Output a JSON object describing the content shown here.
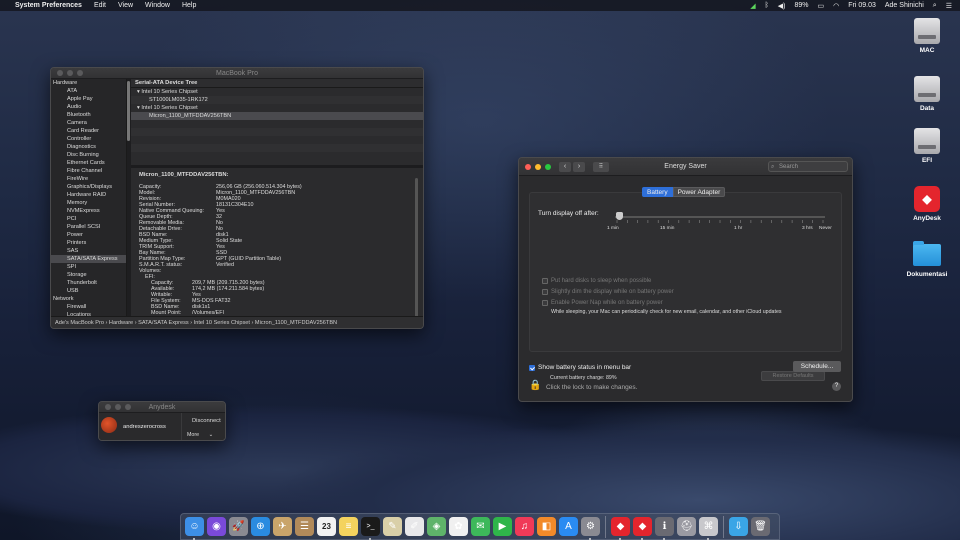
{
  "menubar": {
    "apple": "",
    "app": "System Preferences",
    "items": [
      "Edit",
      "View",
      "Window",
      "Help"
    ],
    "battery": "89%",
    "clock": "Fri 09.03",
    "user": "Ade Shinichi"
  },
  "sysinfo": {
    "title": "MacBook Pro",
    "sidebar": [
      {
        "label": "Hardware",
        "type": "grp"
      },
      {
        "label": "ATA"
      },
      {
        "label": "Apple Pay"
      },
      {
        "label": "Audio"
      },
      {
        "label": "Bluetooth"
      },
      {
        "label": "Camera"
      },
      {
        "label": "Card Reader"
      },
      {
        "label": "Controller"
      },
      {
        "label": "Diagnostics"
      },
      {
        "label": "Disc Burning"
      },
      {
        "label": "Ethernet Cards"
      },
      {
        "label": "Fibre Channel"
      },
      {
        "label": "FireWire"
      },
      {
        "label": "Graphics/Displays"
      },
      {
        "label": "Hardware RAID"
      },
      {
        "label": "Memory"
      },
      {
        "label": "NVMExpress"
      },
      {
        "label": "PCI"
      },
      {
        "label": "Parallel SCSI"
      },
      {
        "label": "Power"
      },
      {
        "label": "Printers"
      },
      {
        "label": "SAS"
      },
      {
        "label": "SATA/SATA Express",
        "selected": true
      },
      {
        "label": "SPI"
      },
      {
        "label": "Storage"
      },
      {
        "label": "Thunderbolt"
      },
      {
        "label": "USB"
      },
      {
        "label": "Network",
        "type": "grp"
      },
      {
        "label": "Firewall"
      },
      {
        "label": "Locations"
      }
    ],
    "tree_header": "Serial-ATA Device Tree",
    "tree": [
      {
        "label": "Intel 10 Series Chipset",
        "level": 1
      },
      {
        "label": "ST1000LM035-1RK172",
        "level": 2
      },
      {
        "label": "Intel 10 Series Chipset",
        "level": 1
      },
      {
        "label": "Micron_1100_MTFDDAV256TBN",
        "level": 2,
        "selected": true
      }
    ],
    "detail_title": "Micron_1100_MTFDDAV256TBN:",
    "details": [
      {
        "k": "Capacity:",
        "v": "256,06 GB (256.060.514.304 bytes)",
        "lvl": 1
      },
      {
        "k": "Model:",
        "v": "Micron_1100_MTFDDAV256TBN",
        "lvl": 1
      },
      {
        "k": "Revision:",
        "v": "M0MA020",
        "lvl": 1
      },
      {
        "k": "Serial Number:",
        "v": "18131C304E10",
        "lvl": 1
      },
      {
        "k": "Native Command Queuing:",
        "v": "Yes",
        "lvl": 1
      },
      {
        "k": "Queue Depth:",
        "v": "32",
        "lvl": 1
      },
      {
        "k": "Removable Media:",
        "v": "No",
        "lvl": 1
      },
      {
        "k": "Detachable Drive:",
        "v": "No",
        "lvl": 1
      },
      {
        "k": "BSD Name:",
        "v": "disk1",
        "lvl": 1
      },
      {
        "k": "Medium Type:",
        "v": "Solid State",
        "lvl": 1
      },
      {
        "k": "TRIM Support:",
        "v": "Yes",
        "lvl": 1
      },
      {
        "k": "Bay Name:",
        "v": "SSD",
        "lvl": 1
      },
      {
        "k": "Partition Map Type:",
        "v": "GPT (GUID Partition Table)",
        "lvl": 1
      },
      {
        "k": "S.M.A.R.T. status:",
        "v": "Verified",
        "lvl": 1
      },
      {
        "k": "Volumes:",
        "v": "",
        "lvl": 1
      },
      {
        "k": "EFI:",
        "v": "",
        "lvl": 2
      },
      {
        "k": "Capacity:",
        "v": "209,7 MB (209.715.200 bytes)",
        "lvl": 3
      },
      {
        "k": "Available:",
        "v": "174,2 MB (174.211.584 bytes)",
        "lvl": 3
      },
      {
        "k": "Writable:",
        "v": "Yes",
        "lvl": 3
      },
      {
        "k": "File System:",
        "v": "MS-DOS FAT32",
        "lvl": 3
      },
      {
        "k": "BSD Name:",
        "v": "disk1s1",
        "lvl": 3
      },
      {
        "k": "Mount Point:",
        "v": "/Volumes/EFI",
        "lvl": 3
      }
    ],
    "path": "Ade's MacBook Pro  ›  Hardware  ›  SATA/SATA Express  ›  Intel 10 Series Chipset  ›  Micron_1100_MTFDDAV256TBN"
  },
  "energy": {
    "title": "Energy Saver",
    "search_placeholder": "Search",
    "tabs": [
      "Battery",
      "Power Adapter"
    ],
    "turn_off_label": "Turn display off after:",
    "slider_labels": [
      "1 min",
      "15 min",
      "1 hr",
      "3 hrs",
      "Never"
    ],
    "slider_value": "1 min",
    "options": [
      "Put hard disks to sleep when possible",
      "Slightly dim the display while on battery power",
      "Enable Power Nap while on battery power"
    ],
    "power_nap_desc": "While sleeping, your Mac can periodically check for new email, calendar, and other iCloud updates",
    "charge": "Current battery charge: 89%",
    "restore": "Restore Defaults",
    "show_status": "Show battery status in menu bar",
    "schedule": "Schedule...",
    "lock_text": "Click the lock to make changes.",
    "help": "?"
  },
  "anydesk": {
    "title": "Anydesk",
    "user": "andreszerocross",
    "disconnect": "Disconnect",
    "more": "More"
  },
  "desktop": [
    {
      "label": "MAC",
      "kind": "disk"
    },
    {
      "label": "Data",
      "kind": "disk"
    },
    {
      "label": "EFI",
      "kind": "disk"
    },
    {
      "label": "AnyDesk",
      "kind": "anydesk"
    },
    {
      "label": "Dokumentasi",
      "kind": "folder"
    }
  ],
  "dock": {
    "calendar_day": "23",
    "items": [
      {
        "name": "finder-icon",
        "glyph": "☺",
        "color": "#3d8fe6",
        "run": true
      },
      {
        "name": "siri-icon",
        "glyph": "◉",
        "color": "#7a4ad9"
      },
      {
        "name": "launchpad-icon",
        "glyph": "🚀",
        "color": "#8a8a92"
      },
      {
        "name": "safari-icon",
        "glyph": "⊕",
        "color": "#2a8be0"
      },
      {
        "name": "mail-icon",
        "glyph": "✈",
        "color": "#c9a46a"
      },
      {
        "name": "contacts-icon",
        "glyph": "☰",
        "color": "#b18a5a"
      },
      {
        "name": "calendar-icon",
        "glyph": "23",
        "color": "#f2f2f2"
      },
      {
        "name": "notes-icon",
        "glyph": "≡",
        "color": "#f4d35e"
      },
      {
        "name": "terminal-icon",
        "glyph": ">_",
        "color": "#1a1a1a",
        "run": true
      },
      {
        "name": "script-editor-icon",
        "glyph": "✎",
        "color": "#d9cfa8"
      },
      {
        "name": "textedit-icon",
        "glyph": "✐",
        "color": "#e8e8ea"
      },
      {
        "name": "maps-icon",
        "glyph": "◈",
        "color": "#5fb36a"
      },
      {
        "name": "photos-icon",
        "glyph": "✿",
        "color": "#f0f0f0"
      },
      {
        "name": "messages-icon",
        "glyph": "✉",
        "color": "#3db85a"
      },
      {
        "name": "facetime-icon",
        "glyph": "▶",
        "color": "#2fb54a"
      },
      {
        "name": "music-icon",
        "glyph": "♫",
        "color": "#f03a58"
      },
      {
        "name": "books-icon",
        "glyph": "◧",
        "color": "#f28a2a"
      },
      {
        "name": "app-store-icon",
        "glyph": "A",
        "color": "#2a8bf2"
      },
      {
        "name": "system-preferences-icon",
        "glyph": "⚙",
        "color": "#8a8a92",
        "run": true
      },
      {
        "name": "sep"
      },
      {
        "name": "anydesk-dock-icon",
        "glyph": "◆",
        "color": "#e4252d",
        "run": true
      },
      {
        "name": "anydesk-2-dock-icon",
        "glyph": "◆",
        "color": "#e4252d",
        "run": true
      },
      {
        "name": "system-info-icon",
        "glyph": "ℹ",
        "color": "#6a6a72",
        "run": true
      },
      {
        "name": "disk-utility-icon",
        "glyph": "⛑",
        "color": "#9a9aa2"
      },
      {
        "name": "network-icon",
        "glyph": "⌘",
        "color": "#c8c8cc",
        "run": true
      },
      {
        "name": "sep"
      },
      {
        "name": "downloads-folder-icon",
        "glyph": "⇩",
        "color": "#3aa5e6"
      },
      {
        "name": "trash-icon",
        "glyph": "🗑",
        "color": "#6a6a72"
      }
    ]
  }
}
